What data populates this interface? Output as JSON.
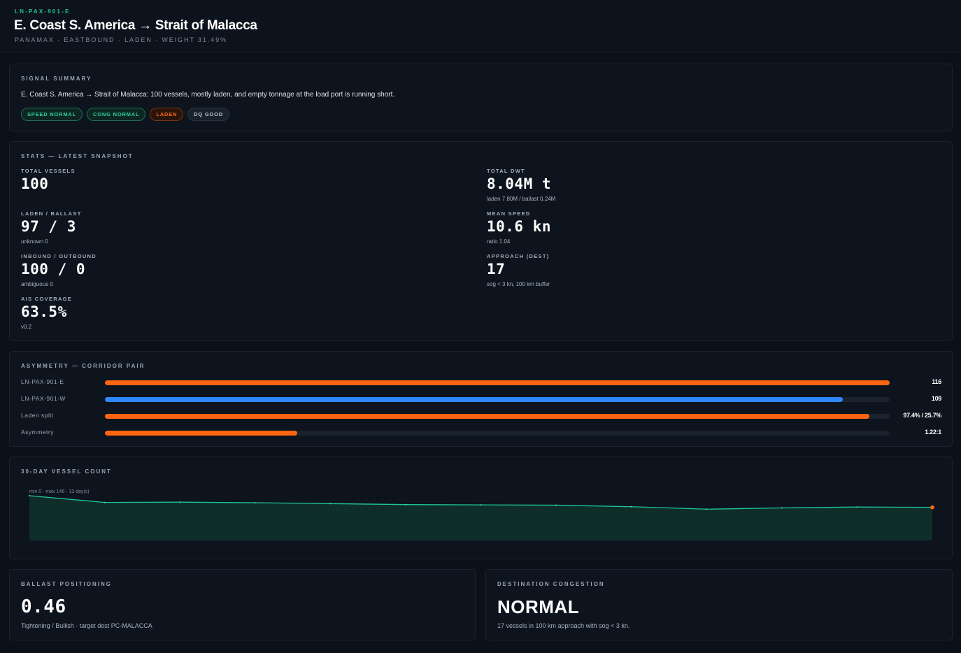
{
  "header": {
    "code": "LN-PAX-901-E",
    "title": "E. Coast S. America → Strait of Malacca",
    "subtitle": "PANAMAX · EASTBOUND · LADEN · WEIGHT 31.49%"
  },
  "summary": {
    "title": "SIGNAL SUMMARY",
    "text": "E. Coast S. America → Strait of Malacca: 100 vessels, mostly laden, and empty tonnage at the load port is running short.",
    "tags": [
      {
        "label": "SPEED NORMAL",
        "color": "green"
      },
      {
        "label": "CONG NORMAL",
        "color": "green"
      },
      {
        "label": "LADEN",
        "color": "orange"
      },
      {
        "label": "DQ GOOD",
        "color": "gray"
      }
    ]
  },
  "stats": {
    "title": "STATS — LATEST SNAPSHOT",
    "total_vessels": {
      "label": "TOTAL VESSELS",
      "value": "100"
    },
    "laden_ballast": {
      "label": "LADEN / BALLAST",
      "value": "97 / 3",
      "note": "unknown 0"
    },
    "inbound_outbound": {
      "label": "INBOUND / OUTBOUND",
      "value": "100 / 0",
      "note": "ambiguous 0"
    },
    "ais_coverage": {
      "label": "AIS COVERAGE",
      "value": "63.5%",
      "note": "v0.2"
    },
    "total_dwt": {
      "label": "TOTAL DWT",
      "value": "8.04M t",
      "note": "laden 7.80M / ballast 0.24M"
    },
    "mean_speed": {
      "label": "MEAN SPEED",
      "value": "10.6 kn",
      "note": "ratio 1.04"
    },
    "approach": {
      "label": "APPROACH (DEST)",
      "value": "17",
      "note": "sog < 3 kn, 100 km buffer"
    }
  },
  "asymmetry": {
    "title": "ASYMMETRY — CORRIDOR PAIR",
    "rows": [
      {
        "label": "LN-PAX-901-E",
        "value": "116",
        "fill": 1.0,
        "color": "#ff6410"
      },
      {
        "label": "LN-PAX-901-W",
        "value": "109",
        "fill": 0.94,
        "color": "#2f86ff"
      },
      {
        "label": "Laden split",
        "value": "97.4% / 25.7%",
        "fill": 0.974,
        "color": "#ff6410"
      },
      {
        "label": "Asymmetry",
        "value": "1.22:1",
        "fill": 0.245,
        "color": "#ff6410"
      }
    ]
  },
  "chart": {
    "title": "30-DAY VESSEL COUNT",
    "caption": "min 0 · max 146 · 13 day(s)"
  },
  "chart_data": {
    "type": "area",
    "x": [
      1,
      2,
      3,
      4,
      5,
      6,
      7,
      8,
      9,
      10,
      11,
      12,
      13
    ],
    "values": [
      146,
      124,
      125,
      123,
      120,
      117,
      116,
      115,
      110,
      102,
      106,
      109,
      108
    ],
    "ylim": [
      0,
      146
    ],
    "title": "30-DAY VESSEL COUNT",
    "xlabel": "",
    "ylabel": "",
    "grid": false,
    "color": "#1fc79a"
  },
  "ballast": {
    "title": "BALLAST POSITIONING",
    "value": "0.46",
    "note": "Tightening / Bullish · target dest PC-MALACCA"
  },
  "congestion": {
    "title": "DESTINATION CONGESTION",
    "value": "NORMAL",
    "note": "17 vessels in 100 km approach with sog < 3 kn."
  }
}
